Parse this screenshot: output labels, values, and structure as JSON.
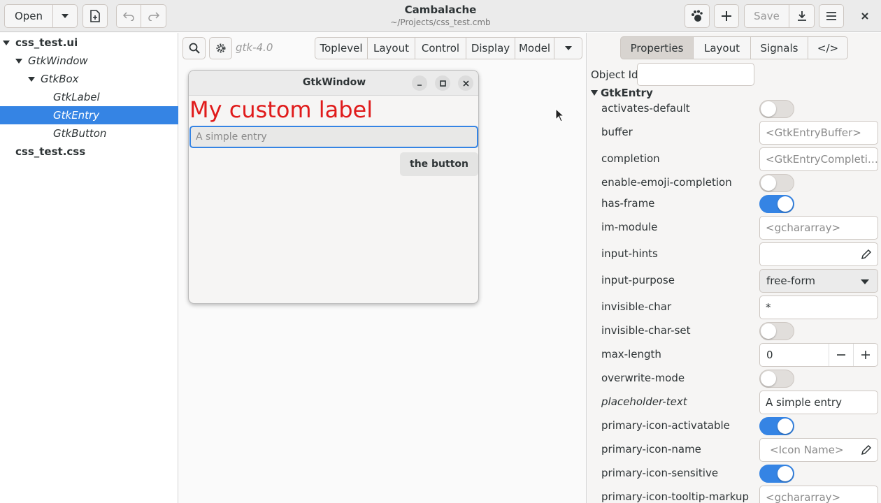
{
  "header": {
    "open_label": "Open",
    "save_label": "Save",
    "title": "Cambalache",
    "subtitle": "~/Projects/css_test.cmb"
  },
  "tree": {
    "items": [
      {
        "label": "css_test.ui",
        "style": "bold",
        "indent": 0,
        "arrow": true
      },
      {
        "label": "GtkWindow",
        "style": "italic",
        "indent": 1,
        "arrow": true
      },
      {
        "label": "GtkBox",
        "style": "italic",
        "indent": 2,
        "arrow": true
      },
      {
        "label": "GtkLabel",
        "style": "italic",
        "indent": 3,
        "arrow": false
      },
      {
        "label": "GtkEntry",
        "style": "italic",
        "indent": 3,
        "arrow": false,
        "selected": true
      },
      {
        "label": "GtkButton",
        "style": "italic",
        "indent": 3,
        "arrow": false
      },
      {
        "label": "css_test.css",
        "style": "bold",
        "indent": 0,
        "arrow": false
      }
    ]
  },
  "center": {
    "gtk_version": "gtk-4.0",
    "categories": [
      "Toplevel",
      "Layout",
      "Control",
      "Display",
      "Model"
    ],
    "preview": {
      "window_title": "GtkWindow",
      "label_text": "My custom label",
      "entry_placeholder": "A simple entry",
      "button_label": "the button",
      "label_color": "#e01b1b"
    }
  },
  "props": {
    "tabs": [
      {
        "label": "Properties",
        "active": true
      },
      {
        "label": "Layout",
        "active": false
      },
      {
        "label": "Signals",
        "active": false
      },
      {
        "label": "</>",
        "active": false
      }
    ],
    "object_id_label": "Object Id",
    "object_id_value": "",
    "section_title": "GtkEntry",
    "rows": [
      {
        "name": "activates-default",
        "kind": "switch",
        "on": false
      },
      {
        "name": "buffer",
        "kind": "field",
        "value": "<GtkEntryBuffer>",
        "placeholder": true
      },
      {
        "name": "completion",
        "kind": "field",
        "value": "<GtkEntryCompleti…",
        "placeholder": true
      },
      {
        "name": "enable-emoji-completion",
        "kind": "switch",
        "on": false
      },
      {
        "name": "has-frame",
        "kind": "switch",
        "on": true
      },
      {
        "name": "im-module",
        "kind": "field",
        "value": "<gchararray>",
        "placeholder": true
      },
      {
        "name": "input-hints",
        "kind": "edit",
        "value": ""
      },
      {
        "name": "input-purpose",
        "kind": "combo",
        "value": "free-form"
      },
      {
        "name": "invisible-char",
        "kind": "field",
        "value": "*",
        "placeholder": false
      },
      {
        "name": "invisible-char-set",
        "kind": "switch",
        "on": false
      },
      {
        "name": "max-length",
        "kind": "spin",
        "value": "0"
      },
      {
        "name": "overwrite-mode",
        "kind": "switch",
        "on": false
      },
      {
        "name": "placeholder-text",
        "kind": "field",
        "value": "A simple entry",
        "placeholder": false,
        "italic": true
      },
      {
        "name": "primary-icon-activatable",
        "kind": "switch",
        "on": true
      },
      {
        "name": "primary-icon-name",
        "kind": "edit",
        "value": "<Icon Name>",
        "placeholder": true
      },
      {
        "name": "primary-icon-sensitive",
        "kind": "switch",
        "on": true
      },
      {
        "name": "primary-icon-tooltip-markup",
        "kind": "field",
        "value": "<gchararray>",
        "placeholder": true
      }
    ]
  },
  "colors": {
    "accent": "#3584e4",
    "selection": "#3584e4"
  }
}
